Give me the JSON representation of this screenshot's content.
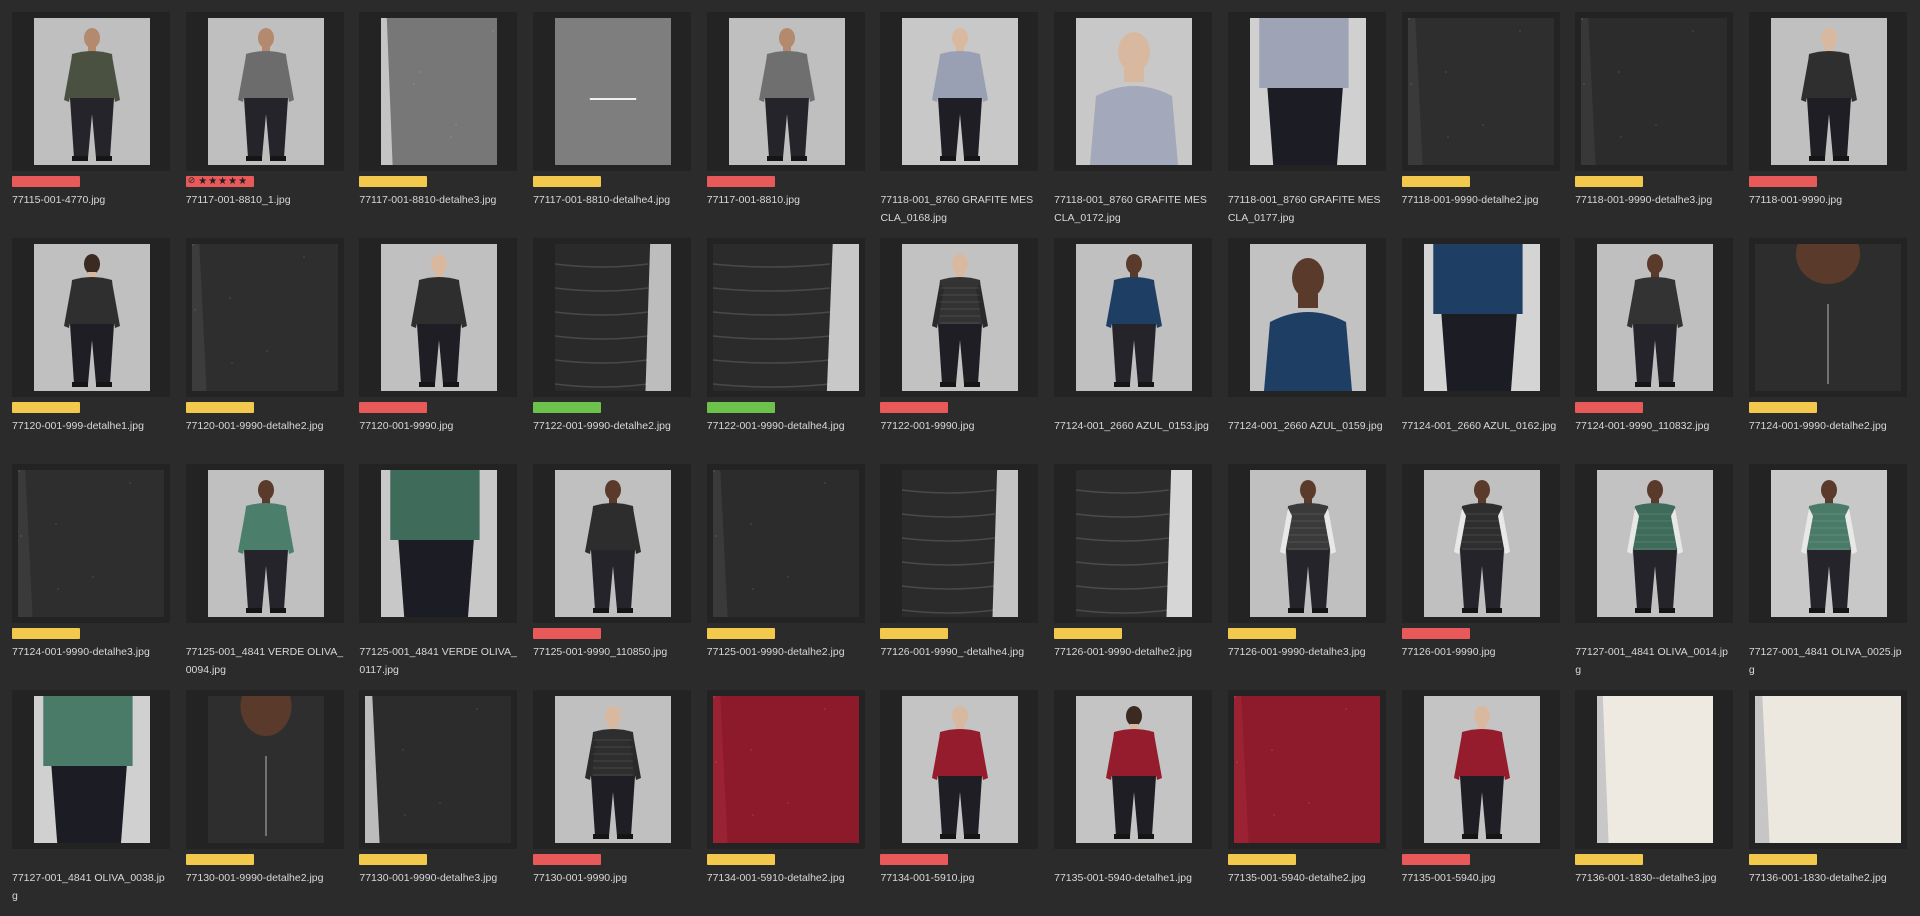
{
  "colors": {
    "background": "#2b2b2b",
    "frame": "#232323",
    "label_red": "#e85a5a",
    "label_yellow": "#f2c94c",
    "label_green": "#6cc24a",
    "text": "#d8d8d8"
  },
  "thumbnails": [
    {
      "filename": "77115-001-4770.jpg",
      "label": "red",
      "shot": "model-man",
      "garment": "#4a5140",
      "bg": "#bfbfbf",
      "orient": "portrait"
    },
    {
      "filename": "77117-001-8810_1.jpg",
      "label": "rated",
      "rating": 5,
      "shot": "model-man",
      "garment": "#6c6c6c",
      "bg": "#bfbfbf",
      "orient": "portrait"
    },
    {
      "filename": "77117-001-8810-detalhe3.jpg",
      "label": "yellow",
      "shot": "detail",
      "garment": "#777777",
      "bg": "#c4c4c4",
      "orient": "portrait"
    },
    {
      "filename": "77117-001-8810-detalhe4.jpg",
      "label": "yellow",
      "shot": "detail-stripe",
      "garment": "#7e7e7e",
      "bg": "#7e7e7e",
      "orient": "portrait"
    },
    {
      "filename": "77117-001-8810.jpg",
      "label": "red",
      "shot": "model-man",
      "garment": "#6f6f6f",
      "bg": "#bfbfbf",
      "orient": "portrait"
    },
    {
      "filename": "77118-001_8760 GRAFITE MESCLA_0168.jpg",
      "label": "none",
      "shot": "model-woman",
      "garment": "#9aa0b4",
      "bg": "#c8c8c8",
      "orient": "portrait"
    },
    {
      "filename": "77118-001_8760 GRAFITE MESCLA_0172.jpg",
      "label": "none",
      "shot": "model-woman-close",
      "garment": "#a3a8ba",
      "bg": "#c8c8c8",
      "orient": "portrait"
    },
    {
      "filename": "77118-001_8760 GRAFITE MESCLA_0177.jpg",
      "label": "none",
      "shot": "detail-pants",
      "garment": "#9ea3b5",
      "bg": "#d0d0d0",
      "orient": "portrait"
    },
    {
      "filename": "77118-001-9990-detalhe2.jpg",
      "label": "yellow",
      "shot": "detail",
      "garment": "#2e2e2e",
      "bg": "#3a3a3a",
      "orient": "wide"
    },
    {
      "filename": "77118-001-9990-detalhe3.jpg",
      "label": "yellow",
      "shot": "detail",
      "garment": "#2c2c2c",
      "bg": "#383838",
      "orient": "wide"
    },
    {
      "filename": "77118-001-9990.jpg",
      "label": "red",
      "shot": "model-woman",
      "garment": "#2f2f2f",
      "bg": "#c0c0c0",
      "orient": "portrait"
    },
    {
      "filename": "77120-001-999-detalhe1.jpg",
      "label": "yellow",
      "shot": "model-woman-back",
      "garment": "#2f2f2f",
      "bg": "#c0c0c0",
      "orient": "portrait"
    },
    {
      "filename": "77120-001-9990-detalhe2.jpg",
      "label": "yellow",
      "shot": "detail",
      "garment": "#2e2e2e",
      "bg": "#3c3c3c",
      "orient": "wide"
    },
    {
      "filename": "77120-001-9990.jpg",
      "label": "red",
      "shot": "model-woman",
      "garment": "#2e2e2e",
      "bg": "#c0c0c0",
      "orient": "portrait"
    },
    {
      "filename": "77122-001-9990-detalhe2.jpg",
      "label": "green",
      "shot": "detail-puffer",
      "garment": "#2a2a2a",
      "bg": "#bdbdbd",
      "orient": "portrait"
    },
    {
      "filename": "77122-001-9990-detalhe4.jpg",
      "label": "green",
      "shot": "detail-puffer",
      "garment": "#2b2b2b",
      "bg": "#c8c8c8",
      "orient": "wide"
    },
    {
      "filename": "77122-001-9990.jpg",
      "label": "red",
      "shot": "model-woman-vest",
      "garment": "#333333",
      "bg": "#c2c2c2",
      "orient": "portrait"
    },
    {
      "filename": "77124-001_2660 AZUL_0153.jpg",
      "label": "none",
      "shot": "model-man",
      "garment": "#1f3e63",
      "bg": "#c0c0c0",
      "orient": "portrait"
    },
    {
      "filename": "77124-001_2660 AZUL_0159.jpg",
      "label": "none",
      "shot": "model-man-close",
      "garment": "#1f3e63",
      "bg": "#c2c2c2",
      "orient": "portrait"
    },
    {
      "filename": "77124-001_2660 AZUL_0162.jpg",
      "label": "none",
      "shot": "detail-pants",
      "garment": "#1f3e63",
      "bg": "#d4d4d4",
      "orient": "portrait"
    },
    {
      "filename": "77124-001-9990_110832.jpg",
      "label": "red",
      "shot": "model-man",
      "garment": "#333333",
      "bg": "#bfbfbf",
      "orient": "portrait"
    },
    {
      "filename": "77124-001-9990-detalhe2.jpg",
      "label": "yellow",
      "shot": "detail-face",
      "garment": "#2d2d2d",
      "bg": "#3a3a3a",
      "orient": "wide"
    },
    {
      "filename": "77124-001-9990-detalhe3.jpg",
      "label": "yellow",
      "shot": "detail",
      "garment": "#2e2e2e",
      "bg": "#3a3a3a",
      "orient": "wide"
    },
    {
      "filename": "77125-001_4841 VERDE OLIVA_0094.jpg",
      "label": "none",
      "shot": "model-man",
      "garment": "#4c7e6c",
      "bg": "#c0c0c0",
      "orient": "portrait"
    },
    {
      "filename": "77125-001_4841 VERDE OLIVA_0117.jpg",
      "label": "none",
      "shot": "detail-pants",
      "garment": "#3f6b5b",
      "bg": "#c8c8c8",
      "orient": "portrait"
    },
    {
      "filename": "77125-001-9990_110850.jpg",
      "label": "red",
      "shot": "model-man",
      "garment": "#2d2d2d",
      "bg": "#c0c0c0",
      "orient": "portrait"
    },
    {
      "filename": "77125-001-9990-detalhe2.jpg",
      "label": "yellow",
      "shot": "detail",
      "garment": "#2c2c2c",
      "bg": "#3a3a3a",
      "orient": "wide"
    },
    {
      "filename": "77126-001-9990_-detalhe4.jpg",
      "label": "yellow",
      "shot": "detail-puffer",
      "garment": "#2b2b2b",
      "bg": "#c4c4c4",
      "orient": "portrait"
    },
    {
      "filename": "77126-001-9990-detalhe2.jpg",
      "label": "yellow",
      "shot": "detail-puffer",
      "garment": "#2c2c2c",
      "bg": "#d6d6d6",
      "orient": "portrait"
    },
    {
      "filename": "77126-001-9990-detalhe3.jpg",
      "label": "yellow",
      "shot": "model-man-vest",
      "garment": "#3a3a3a",
      "bg": "#c0c0c0",
      "orient": "portrait"
    },
    {
      "filename": "77126-001-9990.jpg",
      "label": "red",
      "shot": "model-man-vest",
      "garment": "#2e2e2e",
      "bg": "#c0c0c0",
      "orient": "portrait"
    },
    {
      "filename": "77127-001_4841 OLIVA_0014.jpg",
      "label": "none",
      "shot": "model-man-vest",
      "garment": "#3f6b5b",
      "bg": "#c2c2c2",
      "orient": "portrait"
    },
    {
      "filename": "77127-001_4841 OLIVA_0025.jpg",
      "label": "none",
      "shot": "model-man-vest",
      "garment": "#4a7a68",
      "bg": "#c8c8c8",
      "orient": "portrait"
    },
    {
      "filename": "77127-001_4841 OLIVA_0038.jpg",
      "label": "none",
      "shot": "detail-pants",
      "garment": "#4a7a68",
      "bg": "#d0d0d0",
      "orient": "portrait"
    },
    {
      "filename": "77130-001-9990-detalhe2.jpg",
      "label": "yellow",
      "shot": "detail-face",
      "garment": "#2e2e2e",
      "bg": "#c0c0c0",
      "orient": "portrait"
    },
    {
      "filename": "77130-001-9990-detalhe3.jpg",
      "label": "yellow",
      "shot": "detail",
      "garment": "#2c2c2c",
      "bg": "#bcbcbc",
      "orient": "wide"
    },
    {
      "filename": "77130-001-9990.jpg",
      "label": "red",
      "shot": "model-woman-vest",
      "garment": "#2e2e2e",
      "bg": "#c0c0c0",
      "orient": "portrait"
    },
    {
      "filename": "77134-001-5910-detalhe2.jpg",
      "label": "yellow",
      "shot": "detail",
      "garment": "#8c1a2a",
      "bg": "#9a2232",
      "orient": "wide"
    },
    {
      "filename": "77134-001-5910.jpg",
      "label": "red",
      "shot": "model-woman",
      "garment": "#951c2c",
      "bg": "#c4c4c4",
      "orient": "portrait"
    },
    {
      "filename": "77135-001-5940-detalhe1.jpg",
      "label": "none",
      "shot": "model-woman-back",
      "garment": "#951c2c",
      "bg": "#c4c4c4",
      "orient": "portrait"
    },
    {
      "filename": "77135-001-5940-detalhe2.jpg",
      "label": "yellow",
      "shot": "detail",
      "garment": "#8e1b2b",
      "bg": "#9a2232",
      "orient": "wide"
    },
    {
      "filename": "77135-001-5940.jpg",
      "label": "red",
      "shot": "model-woman",
      "garment": "#951c2c",
      "bg": "#c4c4c4",
      "orient": "portrait"
    },
    {
      "filename": "77136-001-1830--detalhe3.jpg",
      "label": "yellow",
      "shot": "detail",
      "garment": "#eeeae2",
      "bg": "#c8c8c8",
      "orient": "portrait"
    },
    {
      "filename": "77136-001-1830-detalhe2.jpg",
      "label": "yellow",
      "shot": "detail",
      "garment": "#ece8e0",
      "bg": "#c6c6c6",
      "orient": "wide"
    }
  ]
}
